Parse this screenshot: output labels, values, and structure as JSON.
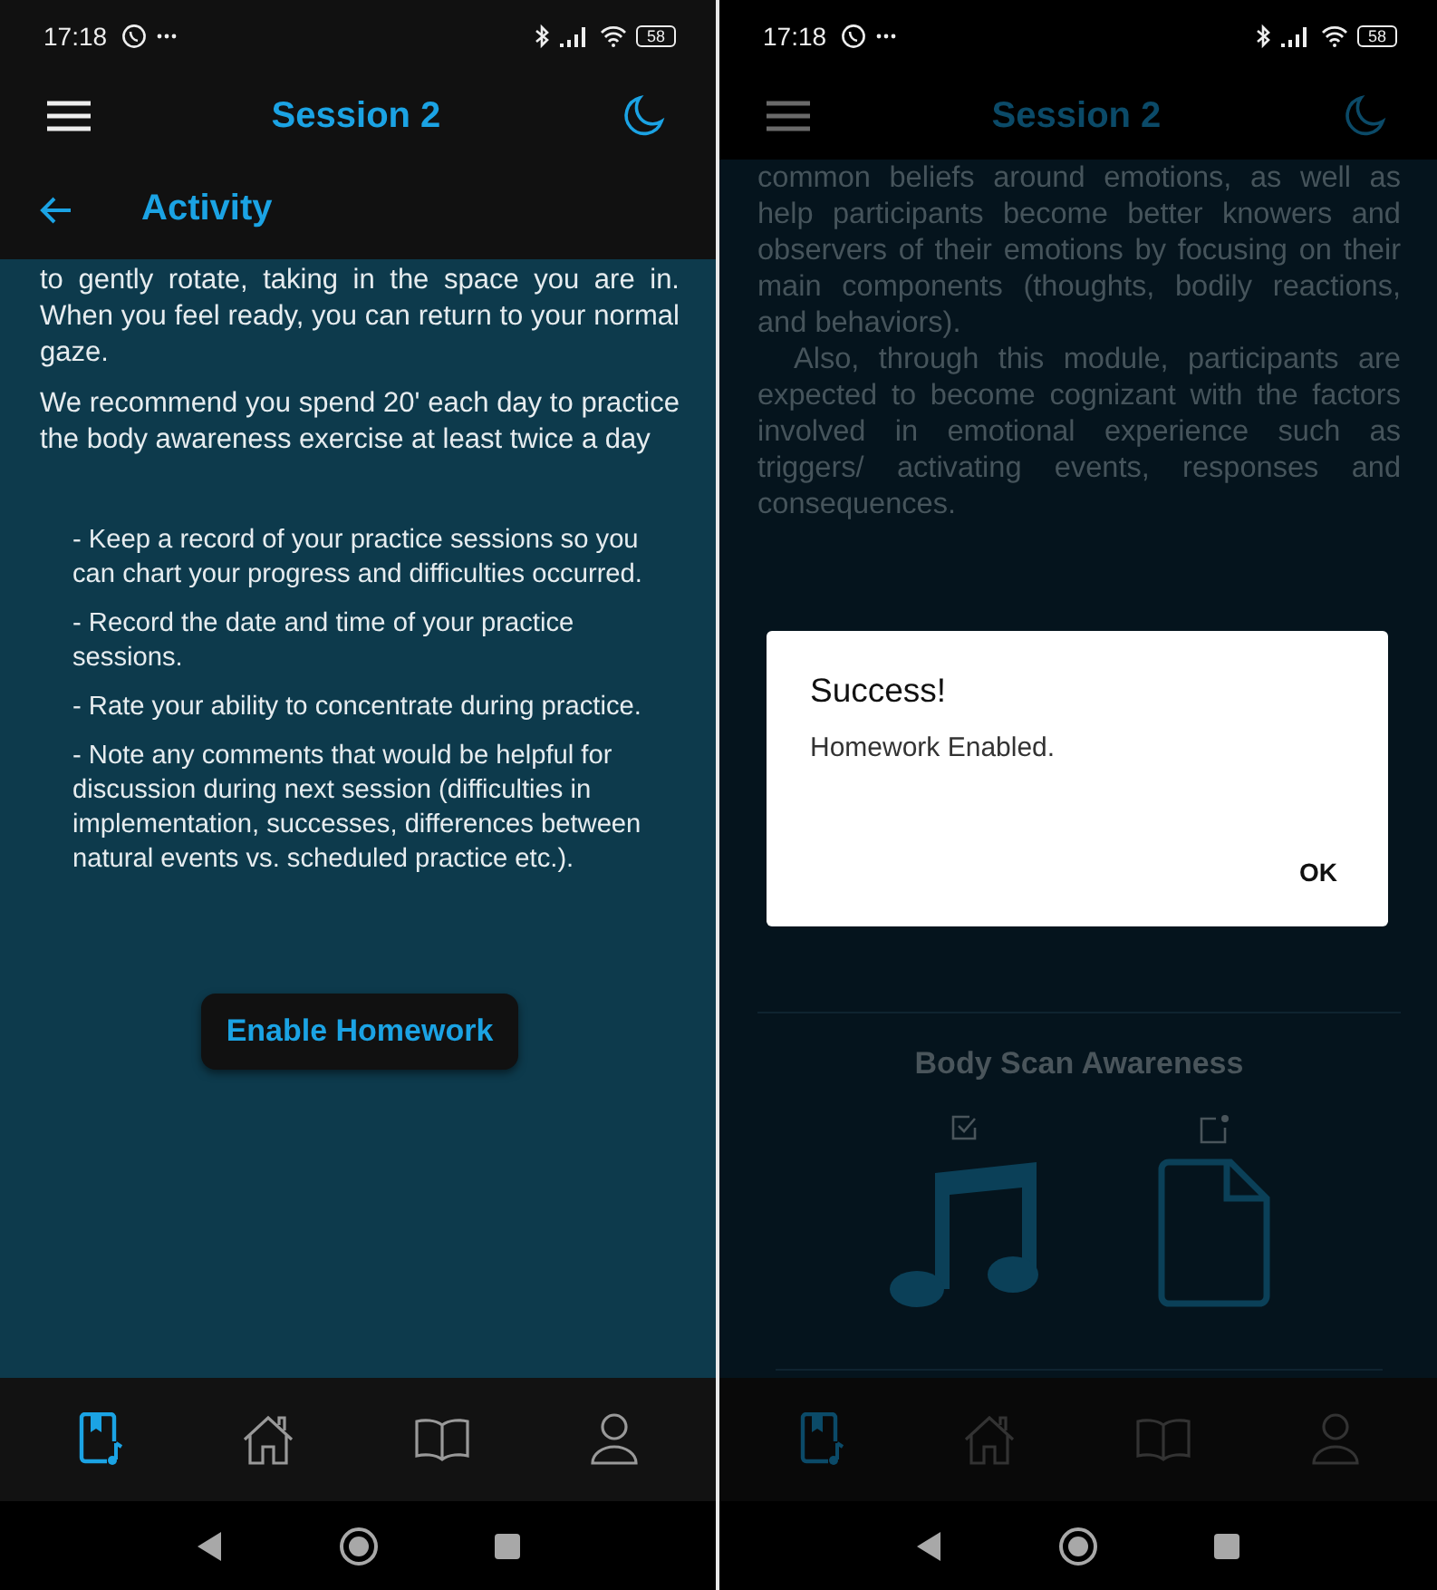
{
  "screens": [
    {
      "kind": "activity",
      "dimmed": false,
      "status_bar": {
        "time": "17:18",
        "battery": "58"
      },
      "app_bar": {
        "title": "Session 2"
      },
      "sub_header": {
        "title": "Activity"
      },
      "paragraphs": [
        "to gently rotate, taking in the space you are in. When you feel ready, you can return to your normal gaze.",
        "We recommend you spend 20' each day to practice the body awareness exercise at least twice a day"
      ],
      "list": [
        "- Keep a record of your practice sessions so you can chart your progress and difficulties occurred.",
        "- Record the date and time of your practice sessions.",
        "- Rate your ability to concentrate during practice.",
        "- Note any comments that would be helpful for discussion during next session (difficulties in implementation, successes, differences between natural events vs. scheduled practice etc.)."
      ],
      "button": "Enable Homework",
      "bottom_nav": [
        {
          "selected": true
        },
        {
          "selected": false
        },
        {
          "selected": false
        },
        {
          "selected": false
        }
      ]
    },
    {
      "kind": "module_dialog",
      "dimmed": true,
      "status_bar": {
        "time": "17:18",
        "battery": "58"
      },
      "app_bar": {
        "title": "Session 2"
      },
      "paragraphs": [
        "common beliefs around emotions, as well as help participants become better knowers and observers of their emotions by focusing on their main components (thoughts, bodily reactions, and behaviors).",
        "Also, through this module, participants are expected to become cognizant with the factors involved in emotional experience such as triggers/ activating events, responses and consequences."
      ],
      "section_title": "Body Scan Awareness",
      "dialog": {
        "title": "Success!",
        "message": "Homework Enabled.",
        "button": "OK"
      },
      "bottom_nav": [
        {
          "selected": true
        },
        {
          "selected": false
        },
        {
          "selected": false
        },
        {
          "selected": false
        }
      ]
    }
  ]
}
